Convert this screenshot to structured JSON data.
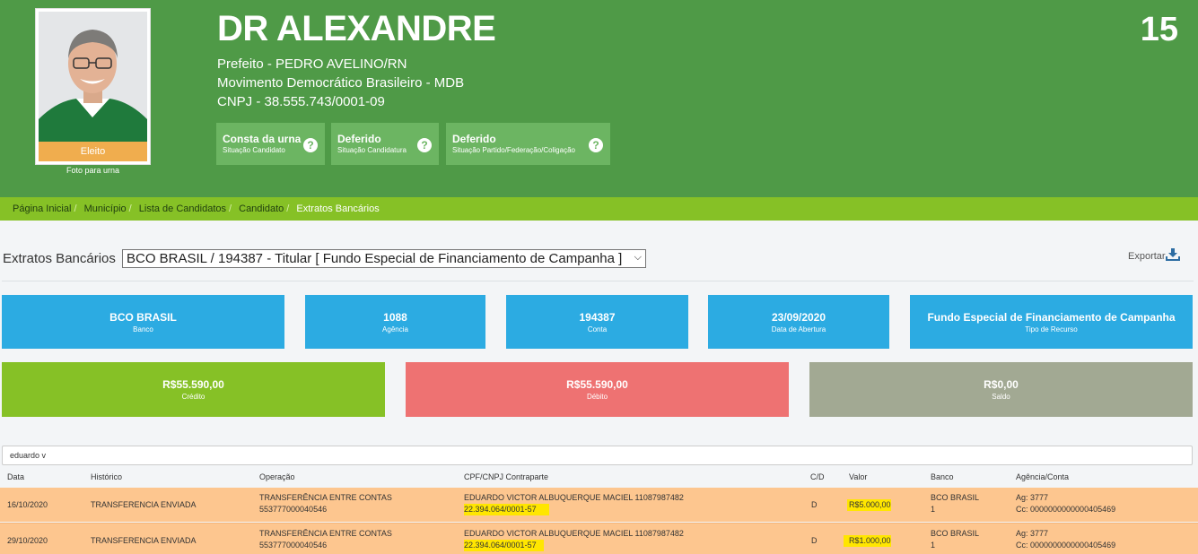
{
  "candidate": {
    "name": "DR ALEXANDRE",
    "number": "15",
    "office": "Prefeito - PEDRO AVELINO/RN",
    "party": "Movimento Democrático Brasileiro - MDB",
    "cnpj": "CNPJ - 38.555.743/0001-09",
    "badge": "Eleito",
    "photo_caption": "Foto para urna"
  },
  "status": [
    {
      "title": "Consta da urna",
      "sub": "Situação Candidato",
      "icon": "question-circle-icon"
    },
    {
      "title": "Deferido",
      "sub": "Situação Candidatura",
      "icon": "question-circle-icon"
    },
    {
      "title": "Deferido",
      "sub": "Situação Partido/Federação/Coligação",
      "icon": "question-circle-icon"
    }
  ],
  "breadcrumb": [
    "Página Inicial",
    "Município",
    "Lista de Candidatos",
    "Candidato",
    "Extratos Bancários"
  ],
  "extratos": {
    "label": "Extratos Bancários",
    "selected": "BCO BRASIL / 194387 - Titular [ Fundo Especial de Financiamento de Campanha ]",
    "export_label": "Exportar",
    "export_icon": "download-icon"
  },
  "account": [
    {
      "value": "BCO BRASIL",
      "label": "Banco"
    },
    {
      "value": "1088",
      "label": "Agência"
    },
    {
      "value": "194387",
      "label": "Conta"
    },
    {
      "value": "23/09/2020",
      "label": "Data de Abertura"
    },
    {
      "value": "Fundo Especial de Financiamento de Campanha",
      "label": "Tipo de Recurso"
    }
  ],
  "summary": [
    {
      "value": "R$55.590,00",
      "label": "Crédito",
      "color": "#86c126"
    },
    {
      "value": "R$55.590,00",
      "label": "Débito",
      "color": "#ee7272"
    },
    {
      "value": "R$0,00",
      "label": "Saldo",
      "color": "#a2a993"
    }
  ],
  "filter": {
    "value": "eduardo v"
  },
  "table": {
    "headers": [
      "Data",
      "Histórico",
      "Operação",
      "CPF/CNPJ Contraparte",
      "C/D",
      "Valor",
      "Banco",
      "Agência/Conta"
    ],
    "rows": [
      {
        "data": "16/10/2020",
        "historico": "TRANSFERENCIA ENVIADA",
        "operacao1": "TRANSFERÊNCIA ENTRE CONTAS",
        "operacao2": "553777000040546",
        "contraparte1": "EDUARDO VICTOR ALBUQUERQUE MACIEL 11087987482",
        "contraparte2": "22.394.064/0001-57",
        "cd": "D",
        "valor": "R$5.000,00",
        "banco1": "BCO BRASIL",
        "banco2": "1",
        "agencia": "Ag: 3777",
        "conta": "Cc: 0000000000000405469"
      },
      {
        "data": "29/10/2020",
        "historico": "TRANSFERENCIA ENVIADA",
        "operacao1": "TRANSFERÊNCIA ENTRE CONTAS",
        "operacao2": "553777000040546",
        "contraparte1": "EDUARDO VICTOR ALBUQUERQUE MACIEL 11087987482",
        "contraparte2": "22.394.064/0001-57",
        "cd": "D",
        "valor": "R$1.000,00",
        "banco1": "BCO BRASIL",
        "banco2": "1",
        "agencia": "Ag: 3777",
        "conta": "Cc: 0000000000000405469"
      }
    ]
  }
}
